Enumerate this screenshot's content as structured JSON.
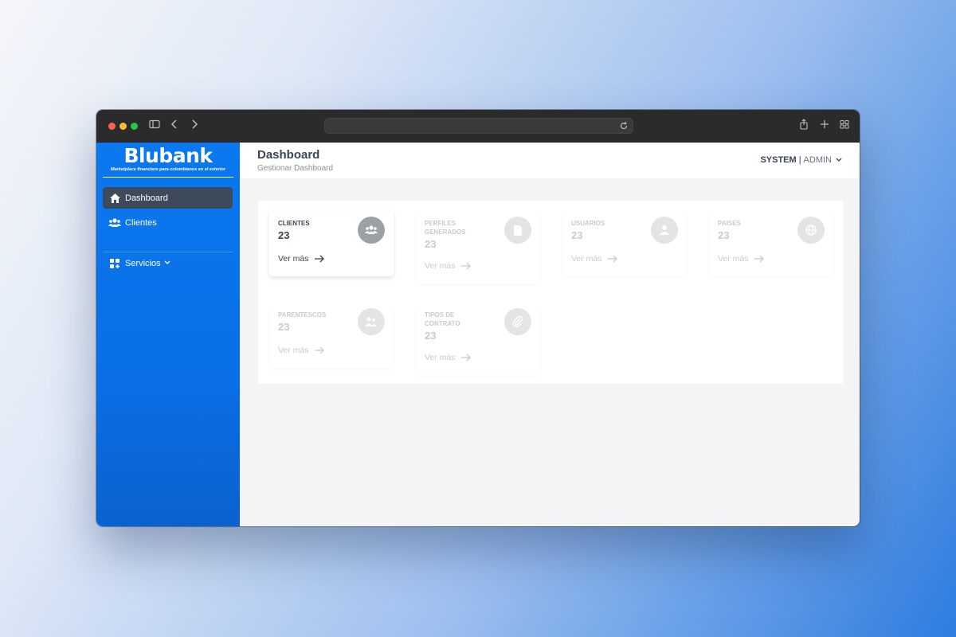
{
  "brand": {
    "name": "Blubank",
    "tagline": "Marketplace financiero para colombianos en el exterior",
    "accent": "#0a78f0"
  },
  "sidebar": {
    "items": [
      {
        "label": "Dashboard",
        "icon": "home-icon",
        "active": true
      },
      {
        "label": "Clientes",
        "icon": "users-icon",
        "active": false
      },
      {
        "label": "Servicios",
        "icon": "grid-plus-icon",
        "active": false
      }
    ]
  },
  "header": {
    "title": "Dashboard",
    "subtitle": "Gestionar Dashboard",
    "user_org": "SYSTEM",
    "user_separator": "|",
    "user_role": "ADMIN"
  },
  "cards": [
    {
      "title": "CLIENTES",
      "count": "23",
      "link": "Ver más",
      "icon": "users-icon"
    },
    {
      "title": "PERFILES GENERADOS",
      "count": "23",
      "link": "Ver más",
      "icon": "document-icon"
    },
    {
      "title": "USUARIOS",
      "count": "23",
      "link": "Ver más",
      "icon": "user-icon"
    },
    {
      "title": "PAISES",
      "count": "23",
      "link": "Ver más",
      "icon": "globe-icon"
    },
    {
      "title": "PARENTESCOS",
      "count": "23",
      "link": "Ver más",
      "icon": "family-icon"
    },
    {
      "title": "TIPOS DE CONTRATO",
      "count": "23",
      "link": "Ver más",
      "icon": "paperclip-icon"
    }
  ]
}
